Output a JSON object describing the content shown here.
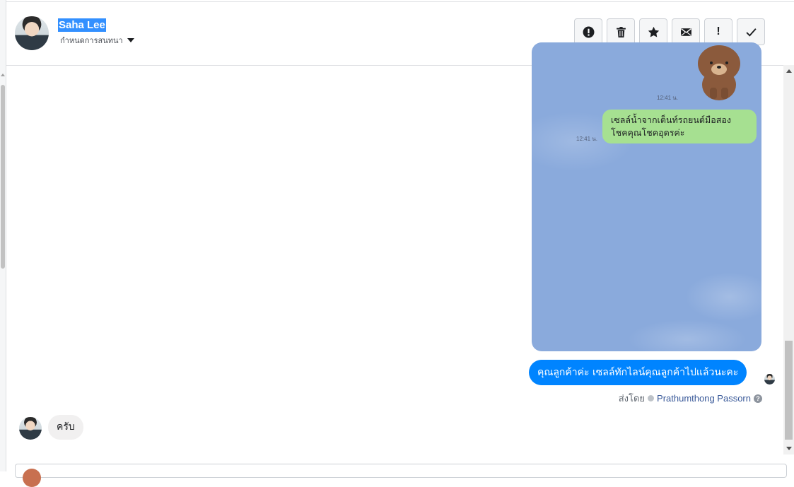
{
  "header": {
    "contact_name": "Saha Lee",
    "conversation_settings_label": "กำหนดการสนทนา",
    "toolbar": [
      {
        "name": "spam-button",
        "icon": "alert-circle-icon"
      },
      {
        "name": "delete-button",
        "icon": "trash-icon"
      },
      {
        "name": "star-button",
        "icon": "star-icon"
      },
      {
        "name": "mark-unread-button",
        "icon": "envelope-icon"
      },
      {
        "name": "important-button",
        "icon": "exclamation-icon",
        "glyph": "!"
      },
      {
        "name": "done-button",
        "icon": "check-icon"
      }
    ]
  },
  "thread": {
    "line_screenshot": {
      "time_top": "12:41 น.",
      "time_bubble": "12:41 น.",
      "bubble_line1": "เซลล์น้ำจากเต็นท์รถยนต์มือสอง",
      "bubble_line2": "โชคคุณโชคอุดรค่ะ"
    },
    "outgoing_message": "คุณลูกค้าค่ะ เซลล์ทักไลน์คุณลูกค้าไปแล้วนะคะ",
    "sent_by_label": "ส่งโดย",
    "sent_by_agent": "Prathumthong Passorn",
    "incoming_message": "ครับ"
  },
  "colors": {
    "accent": "#0084ff",
    "line_bubble": "#a6e091",
    "line_background": "#8aaadc",
    "selection": "#3390ff"
  }
}
